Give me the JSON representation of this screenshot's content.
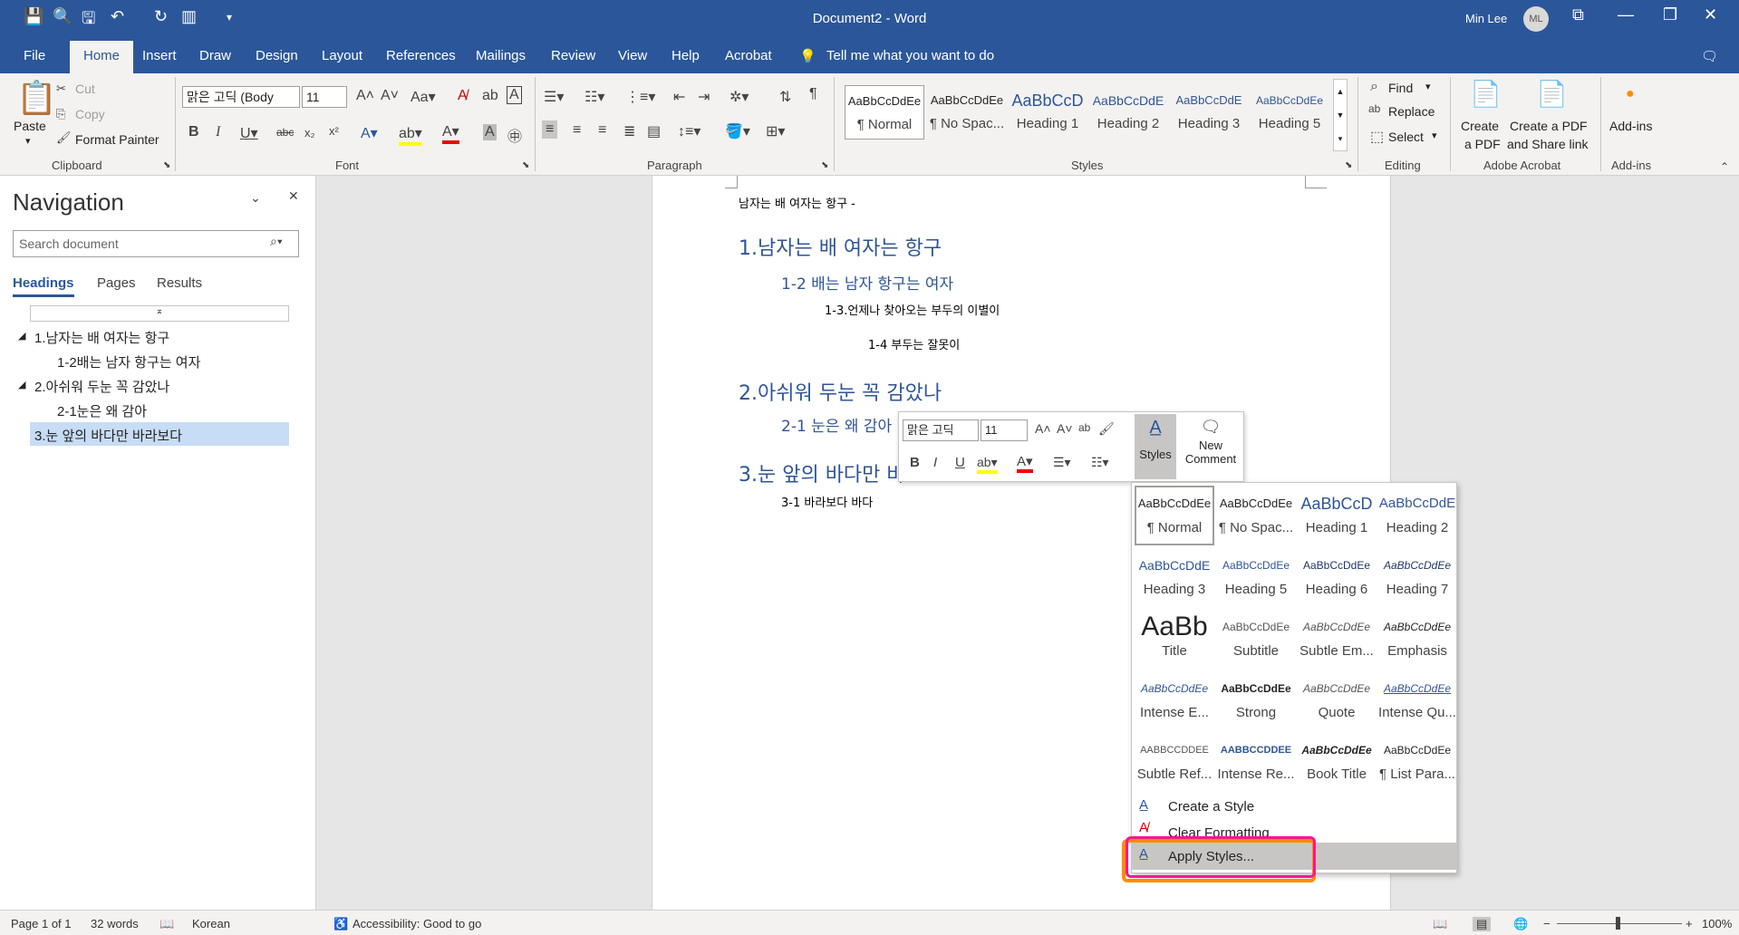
{
  "title_bar": {
    "document_title": "Document2  -  Word",
    "user_name": "Min Lee",
    "avatar_initials": "ML"
  },
  "tabs": [
    "File",
    "Home",
    "Insert",
    "Draw",
    "Design",
    "Layout",
    "References",
    "Mailings",
    "Review",
    "View",
    "Help",
    "Acrobat"
  ],
  "tell_me": "Tell me what you want to do",
  "clipboard": {
    "paste": "Paste",
    "cut": "Cut",
    "copy": "Copy",
    "format_painter": "Format Painter",
    "label": "Clipboard"
  },
  "font": {
    "name": "맑은 고딕 (Body",
    "size": "11",
    "label": "Font"
  },
  "paragraph": {
    "label": "Paragraph"
  },
  "styles_gallery": {
    "label": "Styles",
    "items": [
      {
        "preview": "AaBbCcDdEe",
        "name": "¶ Normal"
      },
      {
        "preview": "AaBbCcDdEe",
        "name": "¶ No Spac..."
      },
      {
        "preview": "AaBbCcD",
        "name": "Heading 1"
      },
      {
        "preview": "AaBbCcDdE",
        "name": "Heading 2"
      },
      {
        "preview": "AaBbCcDdE",
        "name": "Heading 3"
      },
      {
        "preview": "AaBbCcDdEe",
        "name": "Heading 5"
      }
    ]
  },
  "editing": {
    "find": "Find",
    "replace": "Replace",
    "select": "Select",
    "label": "Editing"
  },
  "acrobat": {
    "create_pdf_line1": "Create",
    "create_pdf_line2": "a PDF",
    "share_line1": "Create a PDF",
    "share_line2": "and Share link",
    "label": "Adobe Acrobat"
  },
  "addins": {
    "button": "Add-ins",
    "label": "Add-ins"
  },
  "navigation": {
    "title": "Navigation",
    "search_placeholder": "Search document",
    "tabs": [
      "Headings",
      "Pages",
      "Results"
    ],
    "items": [
      {
        "text": "1.남자는 배 여자는 항구",
        "level": 1
      },
      {
        "text": "1-2배는 남자 항구는 여자",
        "level": 2
      },
      {
        "text": "2.아쉬워 두눈 꼭 감았나",
        "level": 1
      },
      {
        "text": "2-1눈은 왜 감아",
        "level": 2
      },
      {
        "text": "3.눈 앞의 바다만 바라보다",
        "level": 1,
        "selected": true
      }
    ]
  },
  "document": {
    "lines": [
      "남자는 배 여자는 항구 -",
      "1.남자는 배 여자는 항구",
      "1-2 배는 남자 항구는 여자",
      "1-3.언제나 찾아오는 부두의 이별이",
      "1-4 부두는 잘못이",
      "2.아쉬워 두눈 꼭 감았나",
      "2-1 눈은 왜 감아",
      "3.눈 앞의 바다만 바",
      "3-1 바라보다 바다"
    ]
  },
  "mini_toolbar": {
    "font": "맑은 고딕",
    "size": "11",
    "styles": "Styles",
    "new_comment_line1": "New",
    "new_comment_line2": "Comment"
  },
  "styles_dropdown": {
    "cells": [
      {
        "preview": "AaBbCcDdEe",
        "name": "¶ Normal"
      },
      {
        "preview": "AaBbCcDdEe",
        "name": "¶ No Spac..."
      },
      {
        "preview": "AaBbCcD",
        "name": "Heading 1"
      },
      {
        "preview": "AaBbCcDdE",
        "name": "Heading 2"
      },
      {
        "preview": "AaBbCcDdE",
        "name": "Heading 3"
      },
      {
        "preview": "AaBbCcDdEe",
        "name": "Heading 5"
      },
      {
        "preview": "AaBbCcDdEe",
        "name": "Heading 6"
      },
      {
        "preview": "AaBbCcDdEe",
        "name": "Heading 7"
      },
      {
        "preview": "AaBb",
        "name": "Title"
      },
      {
        "preview": "AaBbCcDdEe",
        "name": "Subtitle"
      },
      {
        "preview": "AaBbCcDdEe",
        "name": "Subtle Em..."
      },
      {
        "preview": "AaBbCcDdEe",
        "name": "Emphasis"
      },
      {
        "preview": "AaBbCcDdEe",
        "name": "Intense E..."
      },
      {
        "preview": "AaBbCcDdEe",
        "name": "Strong"
      },
      {
        "preview": "AaBbCcDdEe",
        "name": "Quote"
      },
      {
        "preview": "AaBbCcDdEe",
        "name": "Intense Qu..."
      },
      {
        "preview": "AABBCCDDEE",
        "name": "Subtle Ref..."
      },
      {
        "preview": "AABBCCDDEE",
        "name": "Intense Re..."
      },
      {
        "preview": "AaBbCcDdEe",
        "name": "Book Title"
      },
      {
        "preview": "AaBbCcDdEe",
        "name": "¶ List Para..."
      }
    ],
    "create_style": "Create a Style",
    "clear_formatting": "Clear Formatting",
    "apply_styles": "Apply Styles..."
  },
  "status": {
    "page": "Page 1 of 1",
    "words": "32 words",
    "language": "Korean",
    "accessibility": "Accessibility: Good to go",
    "zoom": "100%"
  },
  "colors": {
    "brand": "#2b579a",
    "heading": "#2f5597",
    "highlight_magenta": "#ff1493",
    "highlight_orange": "#ff8c00"
  }
}
